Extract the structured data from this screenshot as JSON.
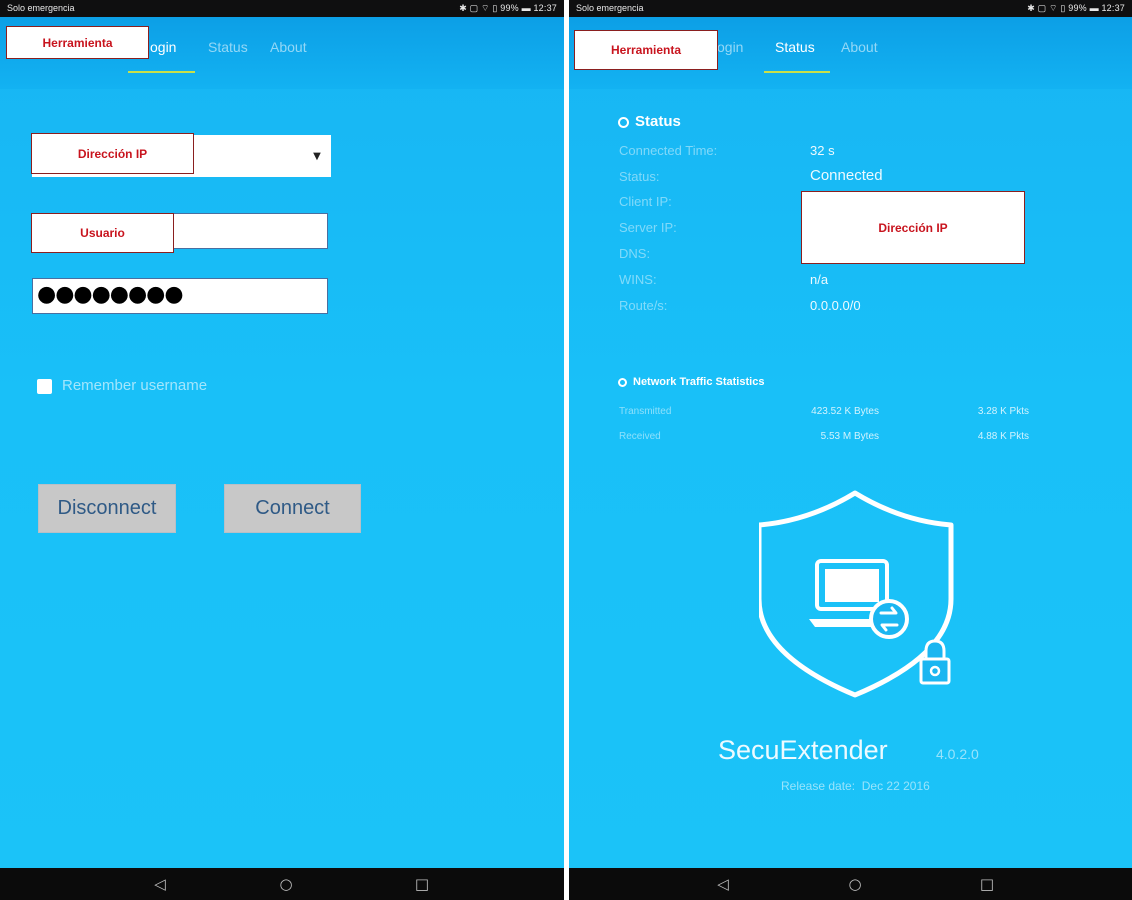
{
  "statusbar": {
    "carrier": "Solo emergencia",
    "indicators": "✱ ▢ ⌔ ▯ 99% ▬ 12:37"
  },
  "left": {
    "tabs": [
      {
        "label": "Login",
        "visible": "ogin"
      },
      {
        "label": "Status"
      },
      {
        "label": "About"
      }
    ],
    "annotations": {
      "tool": "Herramienta",
      "ip": "Dirección IP",
      "user": "Usuario"
    },
    "password_mask": "●●●●●●●●",
    "remember_label": "Remember username",
    "disconnect_label": "Disconnect",
    "connect_label": "Connect"
  },
  "right": {
    "tabs": [
      {
        "label": "Login",
        "visible": "ogin"
      },
      {
        "label": "Status"
      },
      {
        "label": "About"
      }
    ],
    "annotations": {
      "tool": "Herramienta",
      "ip": "Dirección IP"
    },
    "status_title": "Status",
    "status_rows": [
      {
        "label": "Connected Time:",
        "value": "32 s"
      },
      {
        "label": "Status:",
        "value": "Connected"
      },
      {
        "label": "Client IP:",
        "value": ""
      },
      {
        "label": "Server IP:",
        "value": ""
      },
      {
        "label": "DNS:",
        "value": ""
      },
      {
        "label": "WINS:",
        "value": "n/a"
      },
      {
        "label": "Route/s:",
        "value": "0.0.0.0/0"
      }
    ],
    "traffic_title": "Network Traffic Statistics",
    "traffic_rows": [
      {
        "label": "Transmitted",
        "bytes": "423.52 K Bytes",
        "pkts": "3.28 K Pkts"
      },
      {
        "label": "Received",
        "bytes": "5.53 M Bytes",
        "pkts": "4.88 K Pkts"
      }
    ],
    "app_name": "SecuExtender",
    "version": "4.0.2.0",
    "release_label": "Release date:",
    "release_date": "Dec 22 2016"
  },
  "navbar": {
    "back_glyph": "◁",
    "home_glyph": "○",
    "recent_glyph": "□"
  },
  "colors": {
    "background_blue": "#17b5f3",
    "annotation_text": "#c8141e",
    "tab_underline": "#c9e04a"
  },
  "icons": [
    "shield-icon",
    "laptop-icon",
    "lock-icon",
    "sync-icon",
    "dropdown-arrow-icon"
  ]
}
